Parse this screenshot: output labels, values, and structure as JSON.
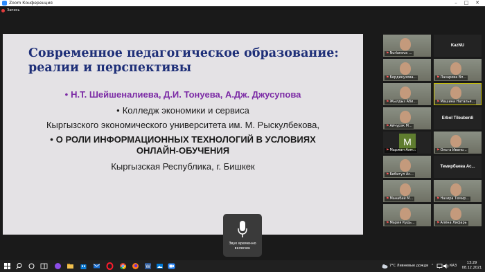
{
  "window": {
    "title": "Zoom Конференция",
    "minimize": "–",
    "maximize": "□",
    "close": "✕"
  },
  "recording": {
    "label": "Запись"
  },
  "slide": {
    "title_line1": "Современное педагогическое образование:",
    "title_line2": "реалии и перспективы",
    "authors": "Н.Т. Шейшеналиева, Д.И. Тонуева, А.Дж. Джусупова",
    "college": "Колледж экономики и сервиса",
    "university": "Кыргызского экономического университета им. М. Рыскулбекова,",
    "topic_line1": "О РОЛИ ИНФОРМАЦИОННЫХ ТЕХНОЛОГИЙ В УСЛОВИЯХ",
    "topic_line2": "ОНЛАЙН-ОБУЧЕНИЯ",
    "location": "Кыргызская Республика, г. Бишкек",
    "bullet": "•"
  },
  "audio_notice": {
    "line1": "Звук временно",
    "line2": "включен"
  },
  "participants": [
    {
      "name": "Nurlanova ...",
      "type": "video"
    },
    {
      "name": "KazNU",
      "type": "name-only"
    },
    {
      "name": "Бердикузова...",
      "type": "video"
    },
    {
      "name": "Лазарева Вл...",
      "type": "video"
    },
    {
      "name": "Жылдыз Аби...",
      "type": "video"
    },
    {
      "name": "Машина Наталья...",
      "type": "video",
      "active": true
    },
    {
      "name": "Айчурэк М...",
      "type": "video"
    },
    {
      "name": "Erbol Tileuberdi",
      "type": "name-only"
    },
    {
      "name": "Маржан Ахм...",
      "type": "letter",
      "letter": "M"
    },
    {
      "name": "Ольга Ивано...",
      "type": "video"
    },
    {
      "name": "Бибигүл Ас...",
      "type": "video"
    },
    {
      "name": "Темирбаева  Ас...",
      "type": "name-only"
    },
    {
      "name": "Манабай М...",
      "type": "video"
    },
    {
      "name": "Назира Темир...",
      "type": "video"
    },
    {
      "name": "Мария Кудь...",
      "type": "video"
    },
    {
      "name": "Алёна Лифарь",
      "type": "video"
    }
  ],
  "taskbar": {
    "weather": "7°C  Ливневые дожди",
    "lang": "КАЗ",
    "time": "13:29",
    "date": "08.12.2021"
  },
  "colors": {
    "slide_title": "#1e2f78",
    "authors": "#7b2aa5",
    "record_dot": "#e23c3c",
    "zoom_blue": "#2d8cff"
  }
}
